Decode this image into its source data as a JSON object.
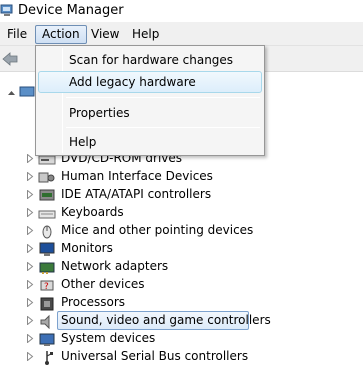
{
  "window": {
    "title": "Device Manager"
  },
  "menubar": {
    "file": "File",
    "action": "Action",
    "view": "View",
    "help": "Help"
  },
  "action_menu": {
    "items": [
      {
        "label": "Scan for hardware changes"
      },
      {
        "label": "Add legacy hardware"
      },
      {
        "label": "Properties"
      },
      {
        "label": "Help"
      }
    ]
  },
  "tree": {
    "categories": [
      {
        "label": "DVD/CD-ROM drives",
        "icon": "dvd-drive-icon"
      },
      {
        "label": "Human Interface Devices",
        "icon": "hid-icon"
      },
      {
        "label": "IDE ATA/ATAPI controllers",
        "icon": "ide-controller-icon"
      },
      {
        "label": "Keyboards",
        "icon": "keyboard-icon"
      },
      {
        "label": "Mice and other pointing devices",
        "icon": "mouse-icon"
      },
      {
        "label": "Monitors",
        "icon": "monitor-icon"
      },
      {
        "label": "Network adapters",
        "icon": "network-adapter-icon"
      },
      {
        "label": "Other devices",
        "icon": "other-devices-icon"
      },
      {
        "label": "Processors",
        "icon": "processor-icon"
      },
      {
        "label": "Sound, video and game controllers",
        "icon": "speaker-icon",
        "selected": true
      },
      {
        "label": "System devices",
        "icon": "system-devices-icon"
      },
      {
        "label": "Universal Serial Bus controllers",
        "icon": "usb-icon"
      }
    ]
  }
}
